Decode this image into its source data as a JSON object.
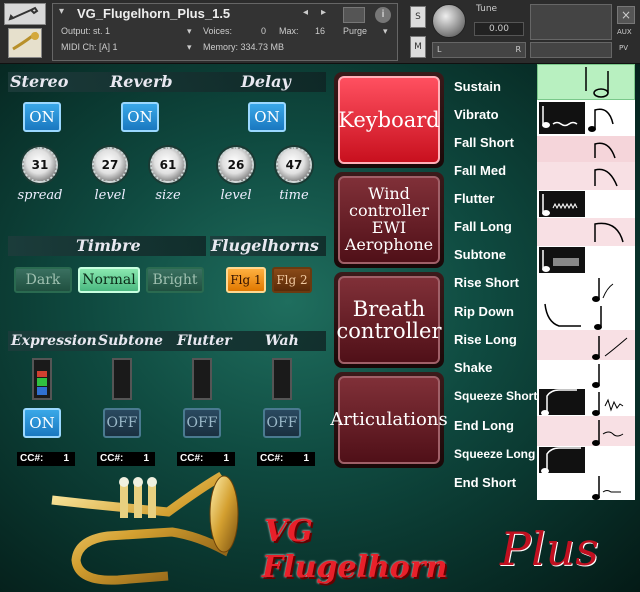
{
  "header": {
    "instrument_name": "VG_Flugelhorn_Plus_1.5",
    "output": "Output: st. 1",
    "voices_label": "Voices:",
    "voices_value": "0",
    "max_label": "Max:",
    "max_value": "16",
    "purge": "Purge",
    "midi_ch": "MIDI Ch: [A] 1",
    "memory": "Memory: 334.73 MB",
    "tune_label": "Tune",
    "tune_value": "0.00",
    "s_label": "S",
    "m_label": "M",
    "l_label": "L",
    "r_label": "R",
    "aux_label": "AUX",
    "pv_label": "PV"
  },
  "effects": {
    "stereo": {
      "title": "Stereo",
      "button": "ON",
      "knob_value": "31",
      "knob_label": "spread"
    },
    "reverb": {
      "title": "Reverb",
      "button": "ON",
      "knob1_value": "27",
      "knob1_label": "level",
      "knob2_value": "61",
      "knob2_label": "size"
    },
    "delay": {
      "title": "Delay",
      "button": "ON",
      "knob1_value": "26",
      "knob1_label": "level",
      "knob2_value": "47",
      "knob2_label": "time"
    }
  },
  "timbre": {
    "title": "Timbre",
    "options": [
      "Dark",
      "Normal",
      "Bright"
    ],
    "selected": "Normal"
  },
  "flugelhorns": {
    "title": "Flugelhorns",
    "options": [
      "Flg 1",
      "Flg 2"
    ],
    "selected": "Flg 1"
  },
  "controllers": [
    {
      "title": "Expression",
      "state": "ON",
      "cc_label": "CC#:",
      "cc_value": "1"
    },
    {
      "title": "Subtone",
      "state": "OFF",
      "cc_label": "CC#:",
      "cc_value": "1"
    },
    {
      "title": "Flutter",
      "state": "OFF",
      "cc_label": "CC#:",
      "cc_value": "1"
    },
    {
      "title": "Wah",
      "state": "OFF",
      "cc_label": "CC#:",
      "cc_value": "1"
    }
  ],
  "modes": {
    "keyboard": "Keyboard",
    "wind_line1": "Wind",
    "wind_line2": "controller",
    "wind_line3": "EWI",
    "wind_line4": "Aerophone",
    "breath_line1": "Breath",
    "breath_line2": "controller",
    "articulations": "Articulations"
  },
  "articulations": [
    "Sustain",
    "Vibrato",
    "Fall Short",
    "Fall Med",
    "Flutter",
    "Fall Long",
    "Subtone",
    "Rise Short",
    "Rip Down",
    "Rise Long",
    "Shake",
    "Squeeze Short",
    "End Long",
    "Squeeze Long",
    "End Short"
  ],
  "brand": {
    "line1": "VG",
    "line2": "Flugelhorn",
    "plus": "Plus"
  },
  "colors": {
    "accent_red": "#e8202a",
    "on_blue": "#2a90d8",
    "timbre_green": "#6ad8a0",
    "flg_orange": "#f09020"
  }
}
